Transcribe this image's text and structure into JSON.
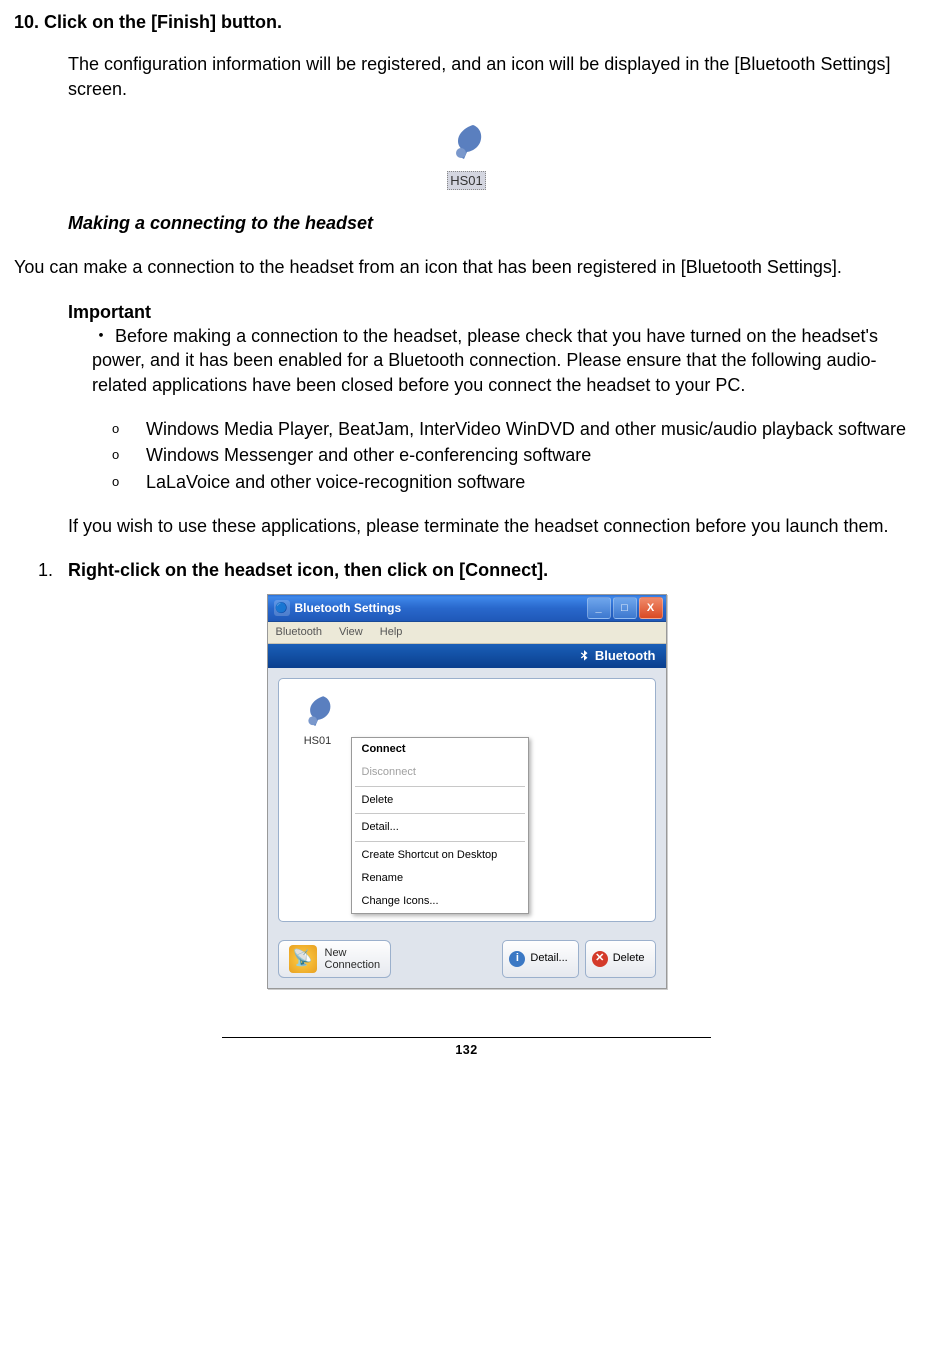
{
  "step10": {
    "num": "10.",
    "title": "Click on the [Finish] button.",
    "desc": "The configuration information will be registered, and an icon will be displayed in the [Bluetooth Settings] screen."
  },
  "hs01_label": "HS01",
  "section_heading": "Making a connecting to the headset",
  "section_intro": "You can make a connection to the headset from an icon that has been registered in [Bluetooth Settings].",
  "important": {
    "label": "Important",
    "bullet_sym": "・",
    "p1": "Before making a connection to the headset, please check that you have turned on the headset's power, and it has been enabled for a Bluetooth connection. Please ensure that the following audio-related applications have been closed before you connect the headset to your PC.",
    "items": [
      "Windows Media Player, BeatJam, InterVideo WinDVD and other music/audio playback software",
      "Windows Messenger and other e-conferencing software",
      "LaLaVoice and other voice-recognition software"
    ],
    "sub_bullet": "o",
    "p2": "If you wish to use these applications, please terminate the headset connection before you launch them."
  },
  "step1": {
    "num": "1.",
    "title": "Right-click on the headset icon, then click on [Connect]."
  },
  "window": {
    "title": "Bluetooth Settings",
    "menus": [
      "Bluetooth",
      "View",
      "Help"
    ],
    "brand": "Bluetooth",
    "device_label": "HS01",
    "context_menu": {
      "connect": "Connect",
      "disconnect": "Disconnect",
      "delete": "Delete",
      "detail": "Detail...",
      "shortcut": "Create Shortcut on Desktop",
      "rename": "Rename",
      "icons": "Change Icons..."
    },
    "buttons": {
      "new_conn": "New\nConnection",
      "detail": "Detail...",
      "delete": "Delete"
    }
  },
  "page_number": "132"
}
